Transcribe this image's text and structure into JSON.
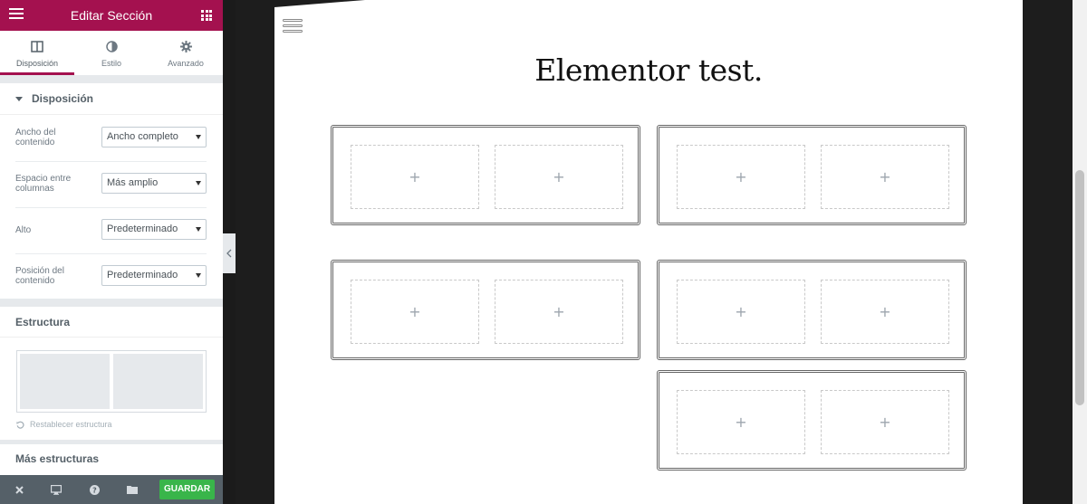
{
  "panel": {
    "title": "Editar Sección",
    "tabs": [
      {
        "label": "Disposición",
        "icon": "columns-icon"
      },
      {
        "label": "Estilo",
        "icon": "contrast-icon"
      },
      {
        "label": "Avanzado",
        "icon": "gear-icon"
      }
    ],
    "layout_section": {
      "title": "Disposición",
      "controls": [
        {
          "label": "Ancho del contenido",
          "value": "Ancho completo"
        },
        {
          "label": "Espacio entre columnas",
          "value": "Más amplio"
        },
        {
          "label": "Alto",
          "value": "Predeterminado"
        },
        {
          "label": "Posición del contenido",
          "value": "Predeterminado"
        }
      ]
    },
    "structure_section": {
      "title": "Estructura",
      "reset_label": "Restablecer estructura"
    },
    "more_structures": "Más estructuras",
    "footer": {
      "save_label": "GUARDAR",
      "icons": [
        "close-icon",
        "desktop-icon",
        "help-icon",
        "folder-icon"
      ]
    }
  },
  "canvas": {
    "page_title": "Elementor test.",
    "add_symbol": "+",
    "section_count": 5,
    "columns_per_section": 2
  },
  "colors": {
    "brand": "#a4114f",
    "save": "#39b54a",
    "footer": "#556068"
  }
}
